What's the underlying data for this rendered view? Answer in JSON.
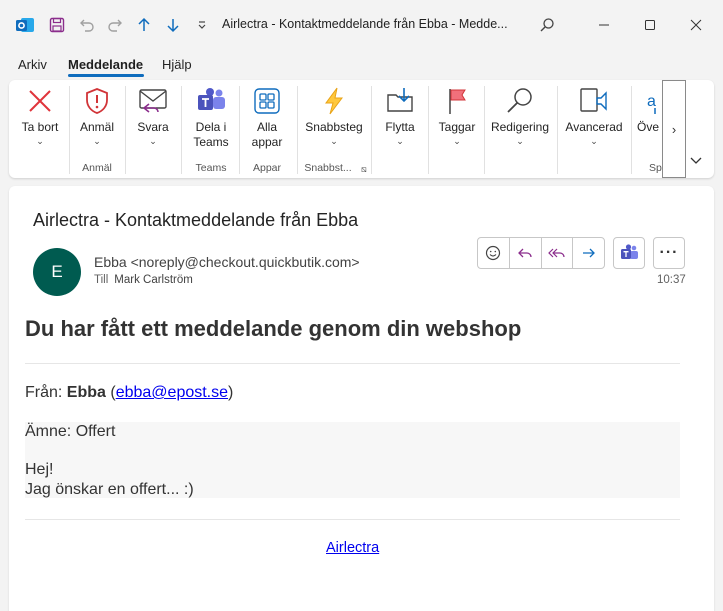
{
  "window": {
    "title": "Airlectra - Kontaktmeddelande från Ebba  -  Medde...",
    "colors": {
      "accent": "#0f6cbd",
      "avatar": "#005b50",
      "outlook": "#0f6cbd"
    }
  },
  "menu": {
    "tabs": [
      "Arkiv",
      "Meddelande",
      "Hjälp"
    ],
    "active": "Meddelande"
  },
  "ribbon": {
    "buttons": {
      "ta_bort": {
        "label": "Ta bort",
        "icon": "delete-x-icon"
      },
      "anmal": {
        "label": "Anmäl",
        "icon": "report-shield-icon"
      },
      "svara": {
        "label": "Svara",
        "icon": "reply-envelope-icon"
      },
      "dela_teams_1": "Dela i",
      "dela_teams_2": "Teams",
      "alla_appar_1": "Alla",
      "alla_appar_2": "appar",
      "snabbsteg": {
        "label": "Snabbsteg",
        "icon": "lightning-icon"
      },
      "flytta": {
        "label": "Flytta",
        "icon": "move-folder-icon"
      },
      "taggar": {
        "label": "Taggar",
        "icon": "flag-icon"
      },
      "redigering": {
        "label": "Redigering",
        "icon": "search-magnifier-icon"
      },
      "avancerad": {
        "label": "Avancerad",
        "icon": "read-aloud-icon"
      },
      "overflow": {
        "label": "Öve",
        "icon": "translate-icon"
      }
    },
    "groups": {
      "anmal": "Anmäl",
      "teams": "Teams",
      "appar": "Appar",
      "snabbsteg": "Snabbst...",
      "sp": "Sp"
    }
  },
  "email": {
    "subject": "Airlectra - Kontaktmeddelande från Ebba",
    "avatar_initial": "E",
    "sender": "Ebba <noreply@checkout.quickbutik.com>",
    "to_label": "Till",
    "to": "Mark Carlström",
    "time": "10:37",
    "body": {
      "heading": "Du har fått ett meddelande genom din webshop",
      "from_label": "Från: ",
      "from_name": "Ebba",
      "from_email": "ebba@epost.se",
      "subject_line": "Ämne: Offert",
      "greeting": "Hej!",
      "message": "Jag önskar en offert... :)",
      "footer_link": "Airlectra"
    }
  }
}
